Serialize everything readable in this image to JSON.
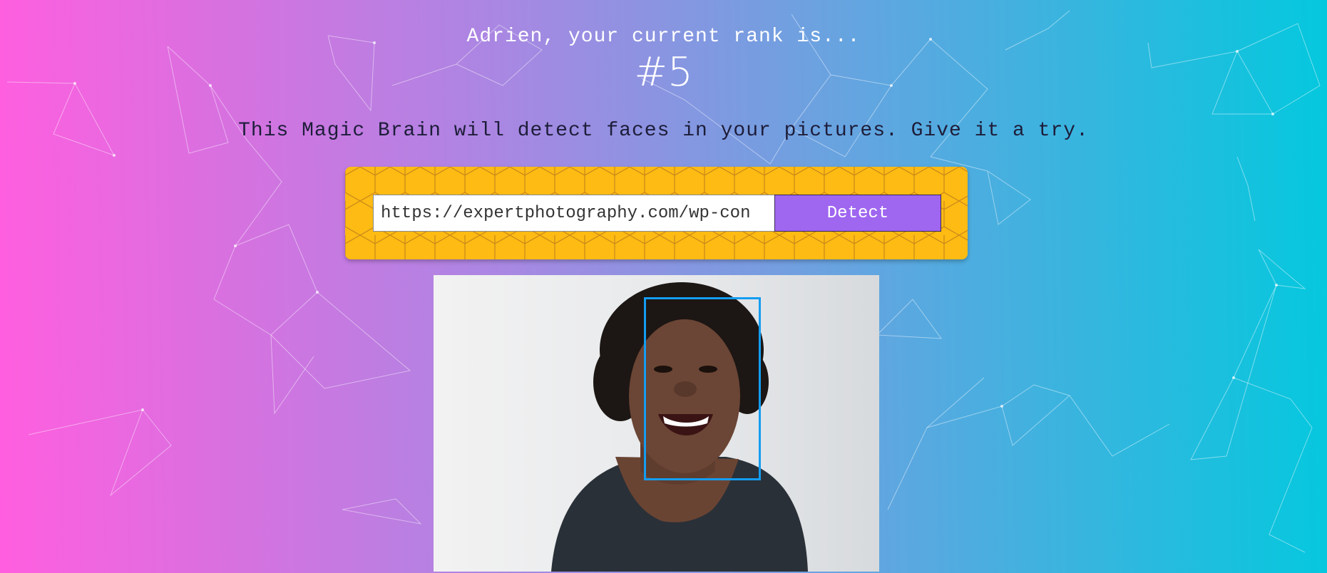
{
  "user": {
    "greeting": "Adrien, your current rank is...",
    "rank": "#5"
  },
  "app": {
    "tagline": "This Magic Brain will detect faces in your pictures. Give it a try."
  },
  "form": {
    "url_value": "https://expertphotography.com/wp-con",
    "detect_label": "Detect"
  },
  "result": {
    "image_subject": "smiling-woman-photo",
    "face_box_color": "#149df2",
    "faces_detected": 1
  },
  "colors": {
    "gradient_left": "#ff5edf",
    "gradient_right": "#04c8de",
    "panel": "#fdbb13",
    "button": "#9f66f0"
  }
}
